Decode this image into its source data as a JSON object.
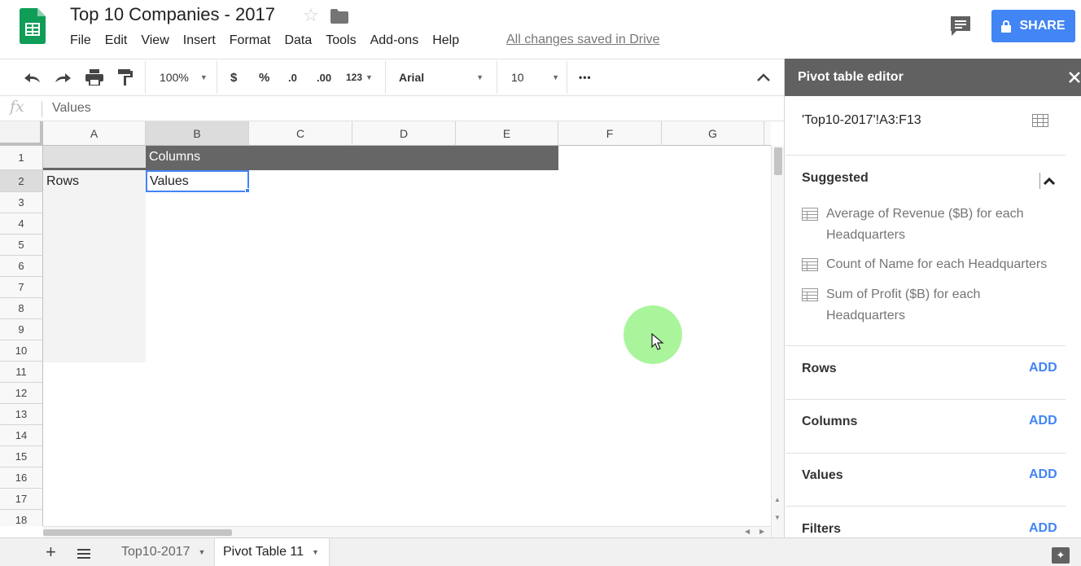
{
  "header": {
    "title": "Top 10 Companies - 2017",
    "menu": [
      "File",
      "Edit",
      "View",
      "Insert",
      "Format",
      "Data",
      "Tools",
      "Add-ons",
      "Help"
    ],
    "save_status": "All changes saved in Drive",
    "share_label": "SHARE"
  },
  "toolbar": {
    "zoom": "100%",
    "currency": "$",
    "percent": "%",
    "decrease_decimal": ".0",
    "increase_decimal": ".00",
    "more_formats": "123",
    "font": "Arial",
    "font_size": "10",
    "more": "•••"
  },
  "formula_bar": {
    "fx_label": "fx",
    "value": "Values"
  },
  "grid": {
    "columns": [
      "A",
      "B",
      "C",
      "D",
      "E",
      "F",
      "G"
    ],
    "rows": [
      "1",
      "2",
      "3",
      "4",
      "5",
      "6",
      "7",
      "8",
      "9",
      "10",
      "11",
      "12",
      "13",
      "14",
      "15",
      "16",
      "17",
      "18"
    ],
    "cells": {
      "b1": "Columns",
      "a2": "Rows",
      "b2": "Values"
    }
  },
  "sheets": {
    "tabs": [
      "Top10-2017",
      "Pivot Table 11"
    ],
    "active": "Pivot Table 11"
  },
  "pivot": {
    "title": "Pivot table editor",
    "range": "'Top10-2017'!A3:F13",
    "suggested_title": "Suggested",
    "suggestions": [
      "Average of Revenue ($B) for each Headquarters",
      "Count of Name for each Headquarters",
      "Sum of Profit ($B) for each Headquarters"
    ],
    "sections": [
      "Rows",
      "Columns",
      "Values",
      "Filters"
    ],
    "add_label": "ADD"
  },
  "colors": {
    "accent": "#4285f4",
    "panel_header": "#616161",
    "pivot_header": "#666666",
    "cursor_highlight": "#aaf59b"
  }
}
